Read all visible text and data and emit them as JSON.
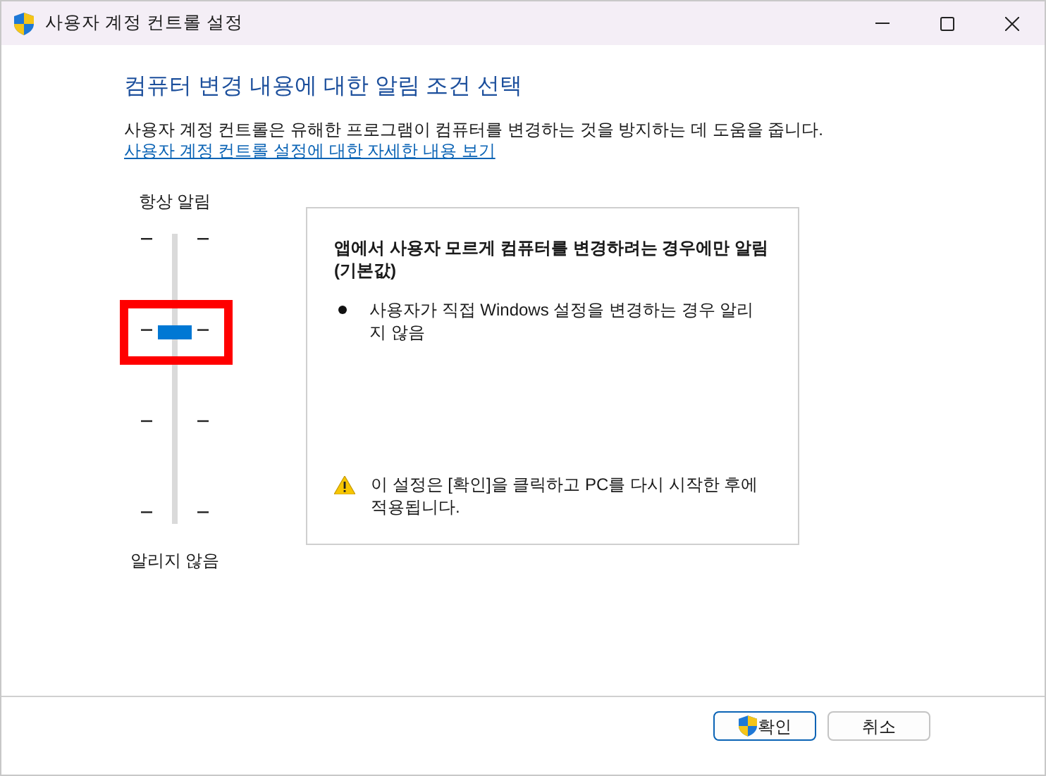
{
  "window": {
    "title": "사용자 계정 컨트롤 설정"
  },
  "heading": "컴퓨터 변경 내용에 대한 알림 조건 선택",
  "description": "사용자 계정 컨트롤은 유해한 프로그램이 컴퓨터를 변경하는 것을 방지하는 데 도움을 줍니다.",
  "link": "사용자 계정 컨트롤 설정에 대한 자세한 내용 보기",
  "slider": {
    "top_label": "항상 알림",
    "bottom_label": "알리지 않음",
    "level": 0.667,
    "highlighted": true
  },
  "info": {
    "title": "앱에서 사용자 모르게 컴퓨터를 변경하려는 경우에만 알림 (기본값)",
    "bullets": [
      "사용자가 직접 Windows 설정을 변경하는 경우 알리지 않음"
    ],
    "warning": "이 설정은 [확인]을 클릭하고 PC를 다시 시작한 후에 적용됩니다."
  },
  "buttons": [
    {
      "label": "확인",
      "kind": "shield",
      "default": true
    },
    {
      "label": "취소",
      "kind": "plain",
      "default": false
    }
  ]
}
